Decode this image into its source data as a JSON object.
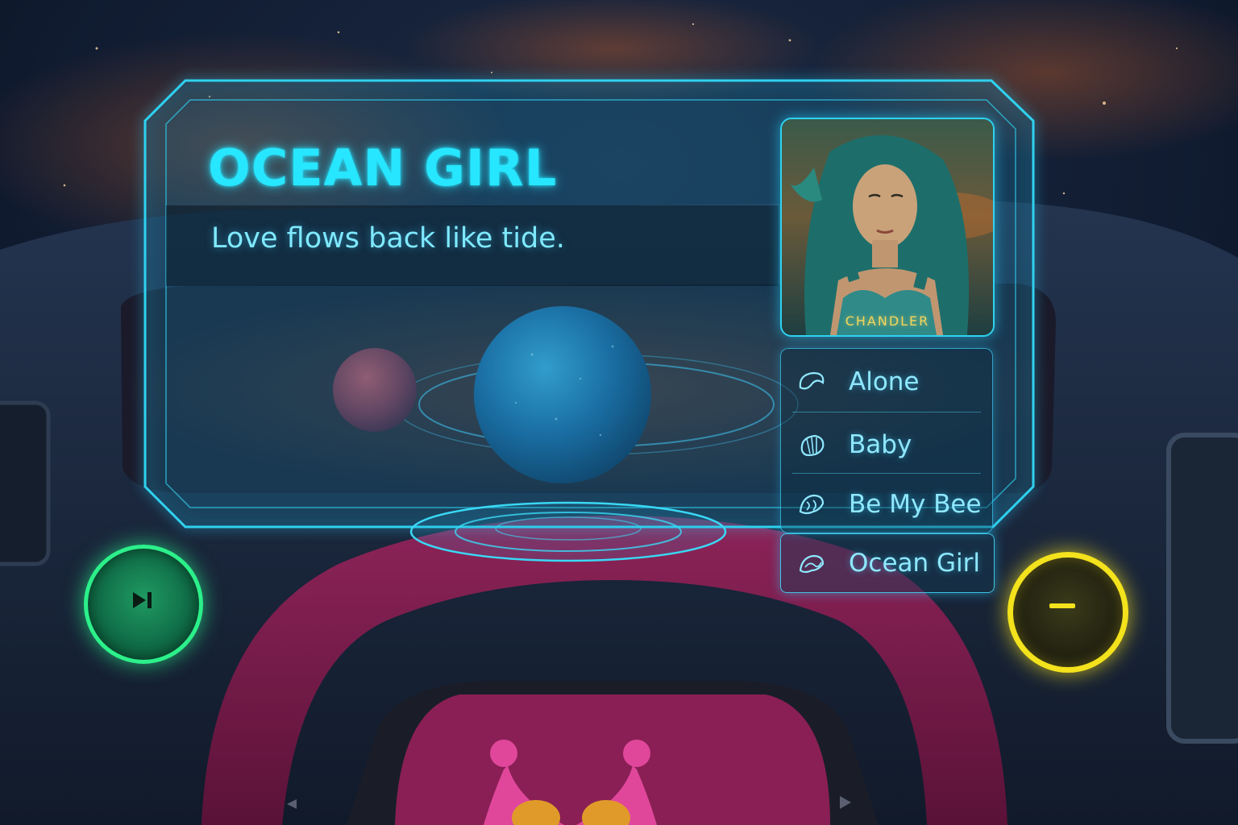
{
  "now_playing": {
    "title": "OCEAN GIRL",
    "lyric": "Love flows back like tide.",
    "artist": "CHANDLER"
  },
  "playlist": {
    "items": [
      {
        "label": "Alone",
        "icon": "moon-shell-icon",
        "active": false
      },
      {
        "label": "Baby",
        "icon": "shell-icon",
        "active": false
      },
      {
        "label": "Be My Bee",
        "icon": "bee-icon",
        "active": false
      },
      {
        "label": "Ocean Girl",
        "icon": "wave-icon",
        "active": true
      }
    ]
  },
  "controls": {
    "next_icon": "skip-next-icon",
    "stop_icon": "minus-icon"
  },
  "colors": {
    "accent": "#27e6ff",
    "next_button": "#2cf08a",
    "stop_button": "#f3e21c",
    "artist_label": "#f3d65a",
    "steering_wheel": "#8a1f55"
  }
}
